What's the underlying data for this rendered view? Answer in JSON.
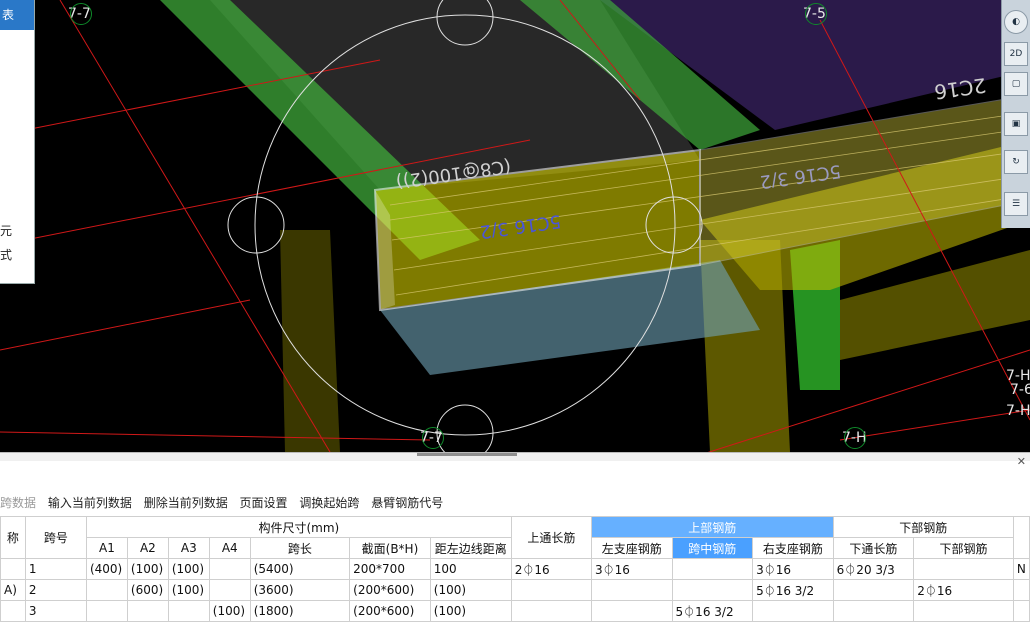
{
  "viewport": {
    "axis_labels": {
      "top_left": "7-7",
      "top_right": "7-5",
      "bottom_center": "7-7",
      "bottom_right": "7-H",
      "right_edge_1": "7-H",
      "right_edge_2": "7-H",
      "right_edge_3": "7-6"
    },
    "beam_labels": {
      "main": "5C16 3/2",
      "stirrup": "(C8@100(2))",
      "second": "5C16 3/2",
      "far": "2C16"
    },
    "left_panel": {
      "header": "表",
      "item_1": "元",
      "item_2": "式"
    },
    "view_toolbar": {
      "btn_2d": "2D"
    }
  },
  "toolbar": {
    "items": [
      "跨数据",
      "输入当前列数据",
      "删除当前列数据",
      "页面设置",
      "调换起始跨",
      "悬臂钢筋代号"
    ]
  },
  "table": {
    "header": {
      "name": "称",
      "span_no": "跨号",
      "size_group": "构件尺寸(mm)",
      "a1": "A1",
      "a2": "A2",
      "a3": "A3",
      "a4": "A4",
      "span_len": "跨长",
      "section": "截面(B*H)",
      "offset": "距左边线距离",
      "top_through": "上通长筋",
      "top_group": "上部钢筋",
      "left_support": "左支座钢筋",
      "mid_span": "跨中钢筋",
      "right_support": "右支座钢筋",
      "bottom_group": "下部钢筋",
      "bottom_through": "下通长筋",
      "bottom_bar": "下部钢筋"
    },
    "rows": [
      {
        "name": "",
        "span": "1",
        "a1": "(400)",
        "a2": "(100)",
        "a3": "(100)",
        "a4": "",
        "len": "(5400)",
        "section": "200*700",
        "offset": "100",
        "top_through": "2⏀16",
        "left": "3⏀16",
        "mid": "",
        "right": "3⏀16",
        "bottom_through": "6⏀20 3/3",
        "bottom": "",
        "extra": "N"
      },
      {
        "name": "A)",
        "span": "2",
        "a1": "",
        "a2": "(600)",
        "a3": "(100)",
        "a4": "",
        "len": "(3600)",
        "section": "(200*600)",
        "offset": "(100)",
        "top_through": "",
        "left": "",
        "mid": "",
        "right": "5⏀16 3/2",
        "bottom_through": "",
        "bottom": "2⏀16",
        "extra": ""
      },
      {
        "name": "",
        "span": "3",
        "a1": "",
        "a2": "",
        "a3": "",
        "a4": "(100)",
        "len": "(1800)",
        "section": "(200*600)",
        "offset": "(100)",
        "top_through": "",
        "left": "",
        "mid": "5⏀16 3/2",
        "right": "",
        "bottom_through": "",
        "bottom": "",
        "extra": ""
      }
    ]
  },
  "colors": {
    "viewport_bg": "#000000",
    "axis_red": "#d01818",
    "beam_yellow": "#e8e000",
    "column_green": "#3fb83a",
    "slab_purple": "#2b1a4a",
    "header_highlight": "#66b0ff"
  }
}
